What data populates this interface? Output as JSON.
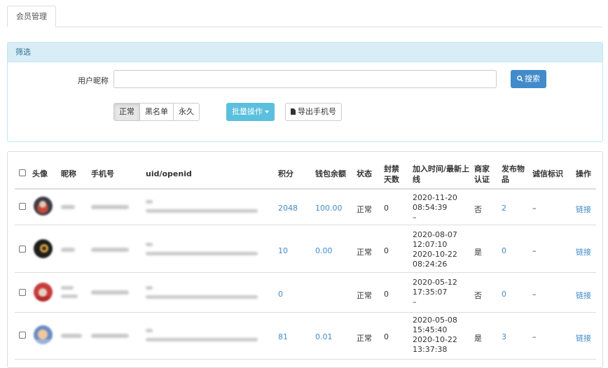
{
  "tabs": [
    {
      "label": "会员管理",
      "active": true
    }
  ],
  "filter": {
    "heading": "筛选",
    "nickname_label": "用户昵称",
    "nickname_value": "",
    "nickname_placeholder": "",
    "search_label": "搜索",
    "segments": [
      {
        "label": "正常",
        "active": true
      },
      {
        "label": "黑名单",
        "active": false
      },
      {
        "label": "永久",
        "active": false
      }
    ],
    "batch_label": "批量操作",
    "export_label": "导出手机号"
  },
  "table": {
    "headers": {
      "avatar": "头像",
      "nickname": "昵称",
      "phone": "手机号",
      "uid": "uid/openid",
      "points": "积分",
      "wallet": "钱包余额",
      "status": "状态",
      "ban_days_1": "封禁",
      "ban_days_2": "天数",
      "time_1": "加入时间/最新上",
      "time_2": "线",
      "merchant_1": "商家",
      "merchant_2": "认证",
      "items_1": "发布物",
      "items_2": "品",
      "credit": "诚信标识",
      "action": "操作"
    },
    "rows": [
      {
        "points": "2048",
        "wallet": "100.00",
        "status": "正常",
        "ban_days": "0",
        "time": [
          "2020-11-20",
          "08:54:39",
          "–"
        ],
        "merchant": "否",
        "items": "2",
        "credit": "–",
        "action": "链接",
        "avatar_colors": [
          "#3d3b45",
          "#c44a3a",
          "#e0c8b8"
        ]
      },
      {
        "points": "10",
        "wallet": "0.00",
        "status": "正常",
        "ban_days": "0",
        "time": [
          "2020-08-07",
          "12:07:10",
          "2020-10-22",
          "08:24:26"
        ],
        "merchant": "是",
        "items": "0",
        "credit": "–",
        "action": "链接",
        "avatar_colors": [
          "#1d1d1d",
          "#e8a83a",
          "#2a2a2a"
        ]
      },
      {
        "points": "0",
        "wallet": "",
        "status": "正常",
        "ban_days": "0",
        "time": [
          "2020-05-12",
          "17:35:07",
          "–"
        ],
        "merchant": "否",
        "items": "0",
        "credit": "–",
        "action": "链接",
        "avatar_colors": [
          "#c83b3b",
          "#e8d0c0",
          "#b02a2a"
        ]
      },
      {
        "points": "81",
        "wallet": "0.01",
        "status": "正常",
        "ban_days": "0",
        "time": [
          "2020-05-08",
          "15:45:40",
          "2020-10-22",
          "13:37:38"
        ],
        "merchant": "是",
        "items": "3",
        "credit": "–",
        "action": "链接",
        "avatar_colors": [
          "#6b8cc4",
          "#f0c8a0",
          "#9ab4d8"
        ]
      }
    ]
  },
  "colors": {
    "primary": "#428bca",
    "info": "#5bc0de",
    "panel_head": "#d9edf7"
  }
}
